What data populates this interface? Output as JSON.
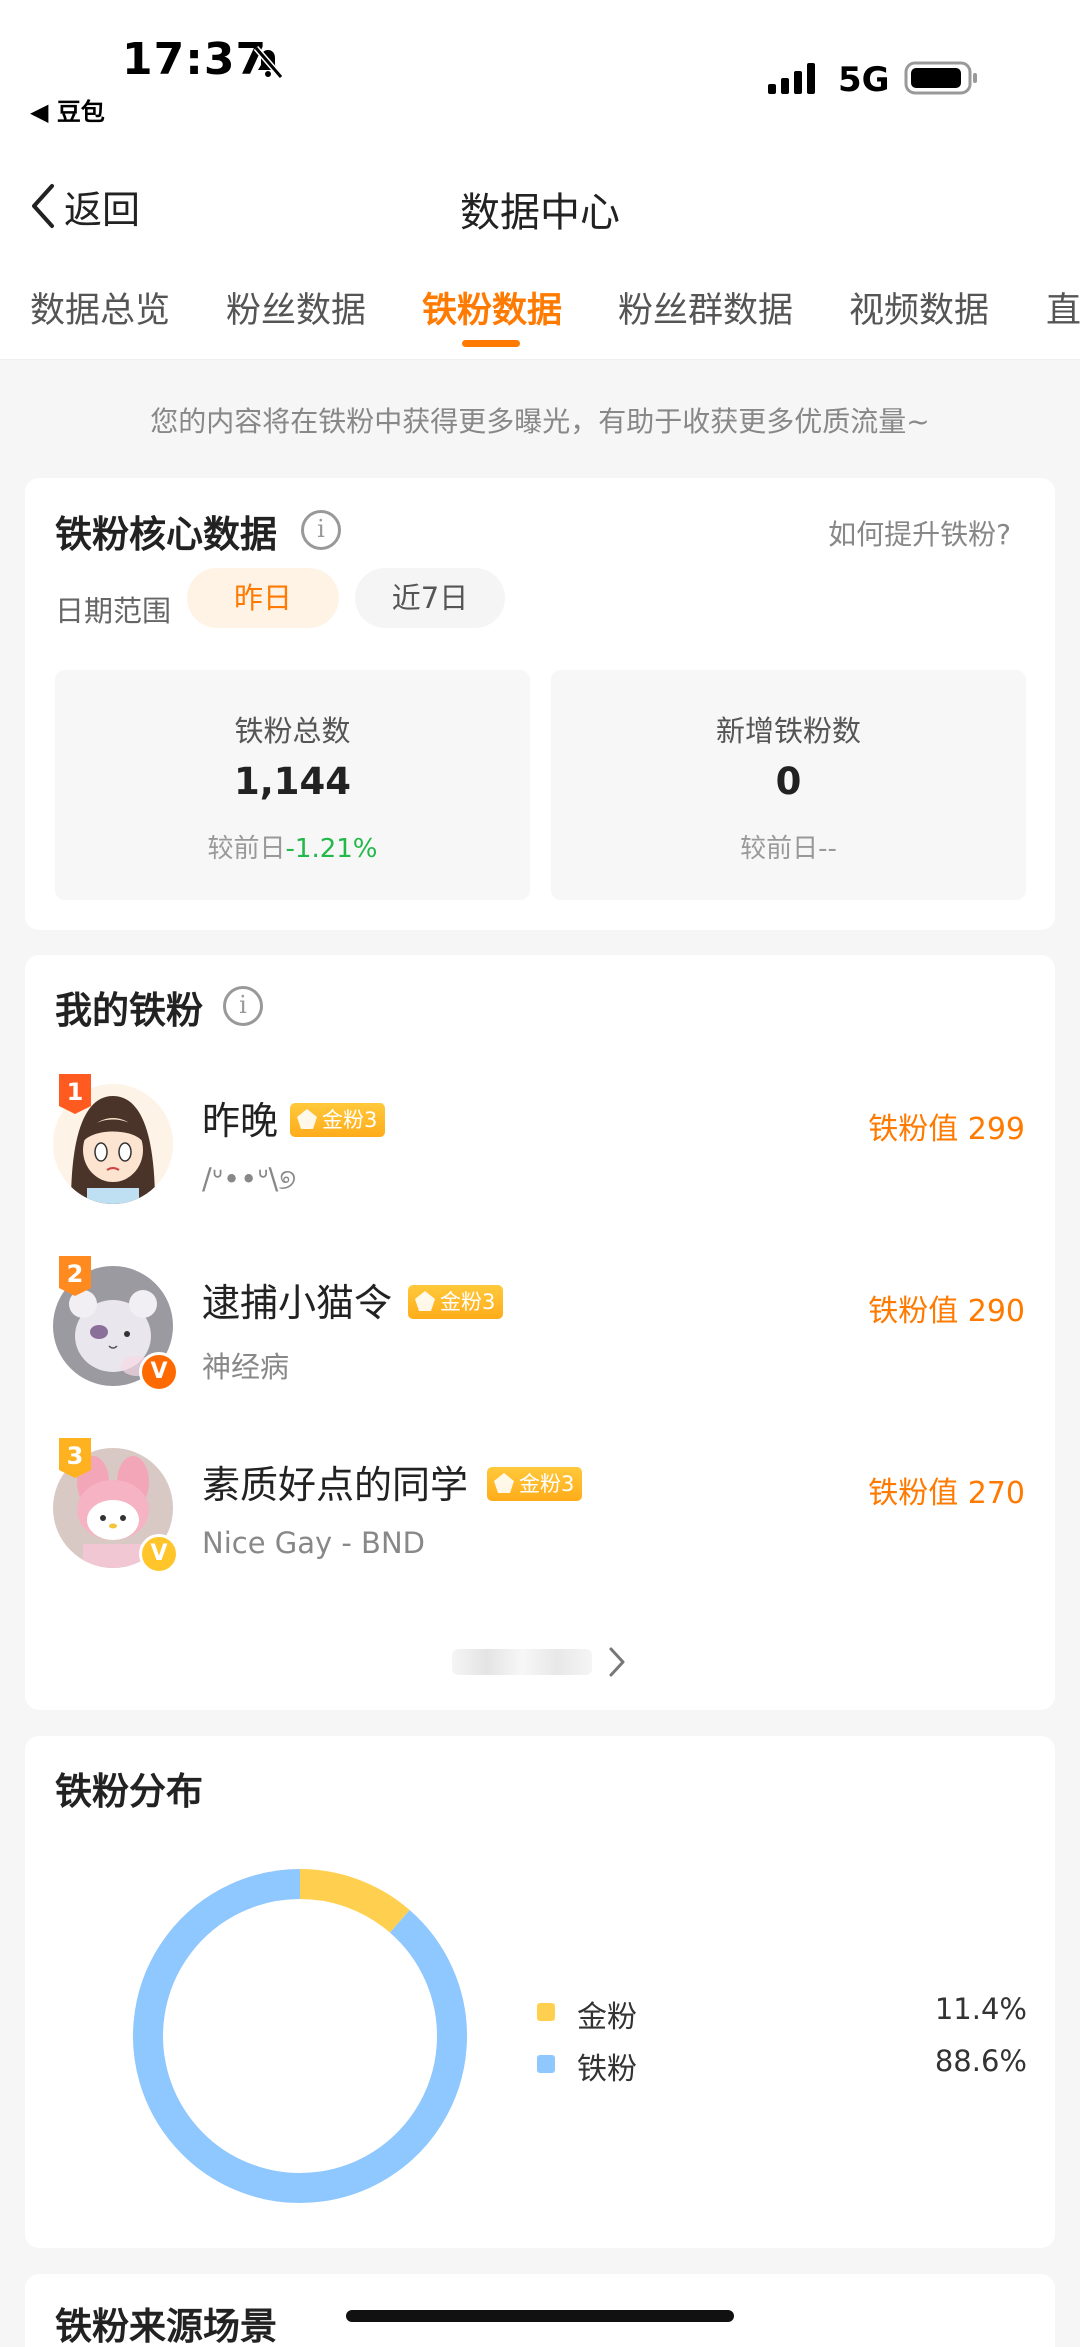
{
  "status_bar": {
    "time": "17:37",
    "back_app": "◀ 豆包",
    "network": "5G"
  },
  "header": {
    "back_label": "返回",
    "title": "数据中心"
  },
  "tabs": [
    {
      "label": "数据总览",
      "active": false
    },
    {
      "label": "粉丝数据",
      "active": false
    },
    {
      "label": "铁粉数据",
      "active": true
    },
    {
      "label": "粉丝群数据",
      "active": false
    },
    {
      "label": "视频数据",
      "active": false
    },
    {
      "label": "直",
      "active": false
    }
  ],
  "banner": "您的内容将在铁粉中获得更多曝光，有助于收获更多优质流量~",
  "core": {
    "title": "铁粉核心数据",
    "how_link": "如何提升铁粉?",
    "date_label": "日期范围",
    "range_options": [
      "昨日",
      "近7日"
    ],
    "selected_range": "昨日",
    "stats": [
      {
        "label": "铁粉总数",
        "value": "1,144",
        "compare_prefix": "较前日",
        "delta": "-1.21%"
      },
      {
        "label": "新增铁粉数",
        "value": "0",
        "compare_prefix": "较前日",
        "delta": "--"
      }
    ]
  },
  "fans": {
    "title": "我的铁粉",
    "items": [
      {
        "rank": "1",
        "name": "昨晚",
        "tag": "金粉3",
        "subtitle": "/ᐡ••ᐡ\\୭",
        "value_label": "铁粉值 299",
        "verified": false
      },
      {
        "rank": "2",
        "name": "逮捕小猫令",
        "tag": "金粉3",
        "subtitle": "神经病",
        "value_label": "铁粉值 290",
        "verified": true,
        "badge_color": "#ff6a00"
      },
      {
        "rank": "3",
        "name": "素质好点的同学",
        "tag": "金粉3",
        "subtitle": "Nice Gay - BND",
        "value_label": "铁粉值 270",
        "verified": true,
        "badge_color": "#ffc52a"
      }
    ]
  },
  "distribution": {
    "title": "铁粉分布",
    "chart_data": {
      "type": "pie",
      "categories": [
        "金粉",
        "铁粉"
      ],
      "values": [
        11.4,
        88.6
      ],
      "labels": [
        "11.4%",
        "88.6%"
      ],
      "colors": [
        "#ffd04f",
        "#8fc7ff"
      ]
    }
  },
  "source": {
    "title": "铁粉来源场景"
  },
  "colors": {
    "accent": "#ff7a00",
    "positive": "#23b84a",
    "gold": "#ffc52a",
    "iron": "#8fc7ff"
  }
}
